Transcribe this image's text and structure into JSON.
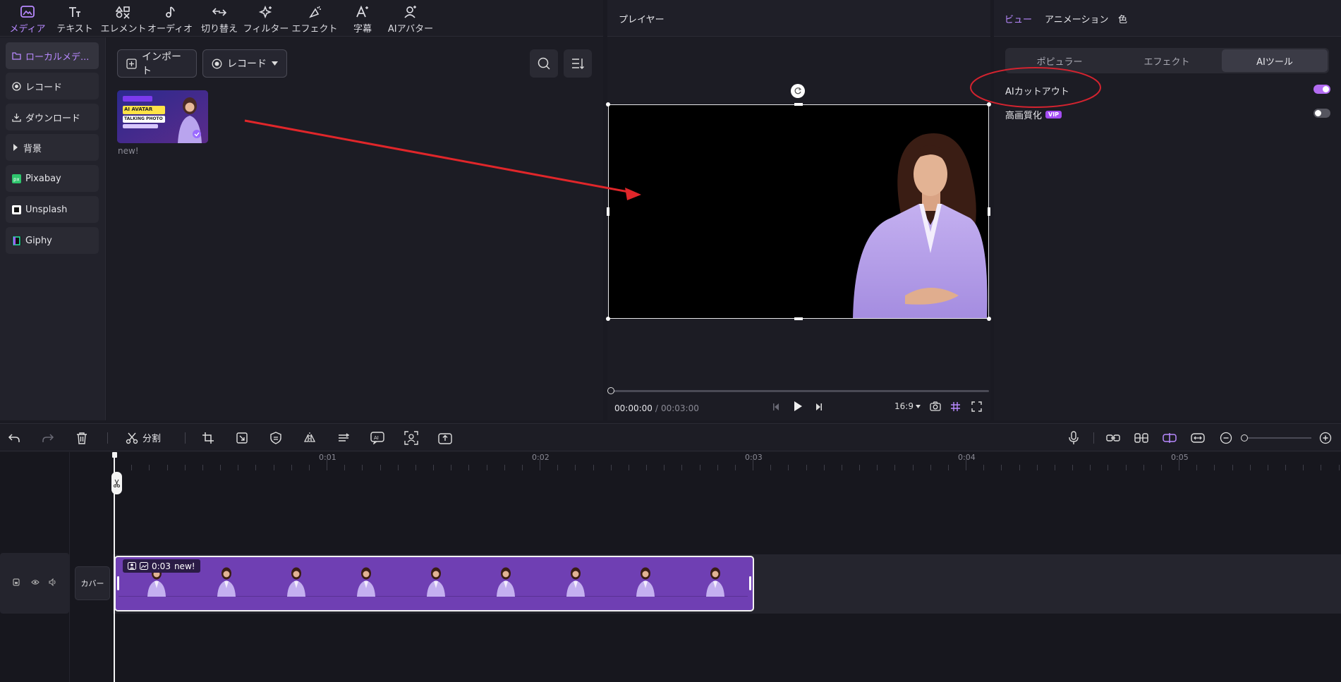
{
  "toolbar": {
    "items": [
      {
        "label": "メディア",
        "icon": "media-icon",
        "active": true
      },
      {
        "label": "テキスト",
        "icon": "text-icon"
      },
      {
        "label": "エレメント",
        "icon": "elements-icon"
      },
      {
        "label": "オーディオ",
        "icon": "audio-icon"
      },
      {
        "label": "切り替え",
        "icon": "transition-icon"
      },
      {
        "label": "フィルター",
        "icon": "filter-icon"
      },
      {
        "label": "エフェクト",
        "icon": "effect-icon"
      },
      {
        "label": "字幕",
        "icon": "caption-icon"
      },
      {
        "label": "AIアバター",
        "icon": "ai-avatar-icon"
      }
    ]
  },
  "sidebar": {
    "items": [
      {
        "label": "ローカルメデ...",
        "icon": "folder-icon",
        "active": true
      },
      {
        "label": "レコード",
        "icon": "record-icon"
      },
      {
        "label": "ダウンロード",
        "icon": "download-icon"
      },
      {
        "label": "背景",
        "icon": "caret-right-icon"
      },
      {
        "label": "Pixabay",
        "icon": "pixabay-icon"
      },
      {
        "label": "Unsplash",
        "icon": "unsplash-icon"
      },
      {
        "label": "Giphy",
        "icon": "giphy-icon"
      }
    ]
  },
  "media": {
    "import_label": "インポート",
    "record_label": "レコード",
    "asset": {
      "name": "new!",
      "thumb_text": [
        "AI AVATAR",
        "TALKING PHOTO"
      ]
    }
  },
  "player": {
    "title": "プレイヤー",
    "current_time": "00:00:00",
    "separator": "/",
    "total_time": "00:03:00",
    "ratio": "16:9",
    "progress": 0
  },
  "right_panel": {
    "tabs": [
      "ビュー",
      "アニメーション",
      "色"
    ],
    "active_tab": "ビュー",
    "segments": [
      "ポピュラー",
      "エフェクト",
      "AIツール"
    ],
    "active_segment": "AIツール",
    "tools": [
      {
        "label": "AIカットアウト",
        "enabled": true
      },
      {
        "label": "高画質化",
        "badge": "VIP",
        "enabled": false
      }
    ]
  },
  "timeline": {
    "split_label": "分割",
    "ruler_ticks": [
      "0:01",
      "0:02",
      "0:03",
      "0:04",
      "0:05"
    ],
    "cover_label": "カバー",
    "clip": {
      "duration": "0:03",
      "name": "new!"
    }
  },
  "colors": {
    "accent": "#b889ff",
    "clip": "#6f3fb3",
    "annotation": "#e0262a"
  }
}
